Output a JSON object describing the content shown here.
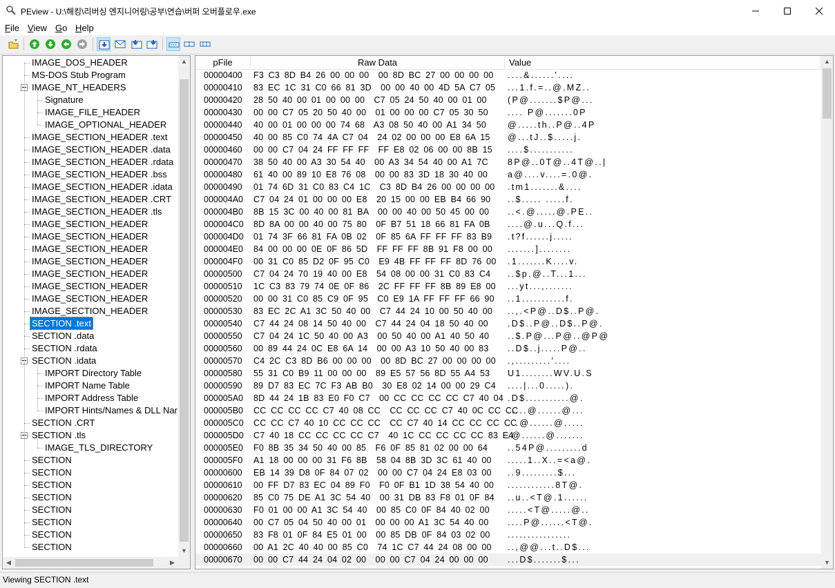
{
  "window": {
    "title": "PEview - U:\\해킹\\리버싱 엔지니어링\\공부\\연습\\버퍼 오버플로우.exe"
  },
  "menu": [
    {
      "label": "File",
      "u": "F",
      "rest": "ile"
    },
    {
      "label": "View",
      "u": "V",
      "rest": "iew"
    },
    {
      "label": "Go",
      "u": "G",
      "rest": "o"
    },
    {
      "label": "Help",
      "u": "H",
      "rest": "elp"
    }
  ],
  "toolbar": {
    "icons": [
      "open-icon",
      "back-icon",
      "forward-icon",
      "up-icon",
      "down-icon",
      "view-hex-icon",
      "view-mail-icon",
      "view-export-icon",
      "view-import-icon",
      "view-list-icon",
      "view-columns-icon",
      "view-details-icon"
    ]
  },
  "tree": [
    {
      "label": "IMAGE_DOS_HEADER",
      "level": 0
    },
    {
      "label": "MS-DOS Stub Program",
      "level": 0
    },
    {
      "label": "IMAGE_NT_HEADERS",
      "level": 0,
      "expander": true
    },
    {
      "label": "Signature",
      "level": 1
    },
    {
      "label": "IMAGE_FILE_HEADER",
      "level": 1
    },
    {
      "label": "IMAGE_OPTIONAL_HEADER",
      "level": 1
    },
    {
      "label": "IMAGE_SECTION_HEADER .text",
      "level": 0
    },
    {
      "label": "IMAGE_SECTION_HEADER .data",
      "level": 0
    },
    {
      "label": "IMAGE_SECTION_HEADER .rdata",
      "level": 0
    },
    {
      "label": "IMAGE_SECTION_HEADER .bss",
      "level": 0
    },
    {
      "label": "IMAGE_SECTION_HEADER .idata",
      "level": 0
    },
    {
      "label": "IMAGE_SECTION_HEADER .CRT",
      "level": 0
    },
    {
      "label": "IMAGE_SECTION_HEADER .tls",
      "level": 0
    },
    {
      "label": "IMAGE_SECTION_HEADER",
      "level": 0
    },
    {
      "label": "IMAGE_SECTION_HEADER",
      "level": 0
    },
    {
      "label": "IMAGE_SECTION_HEADER",
      "level": 0
    },
    {
      "label": "IMAGE_SECTION_HEADER",
      "level": 0
    },
    {
      "label": "IMAGE_SECTION_HEADER",
      "level": 0
    },
    {
      "label": "IMAGE_SECTION_HEADER",
      "level": 0
    },
    {
      "label": "IMAGE_SECTION_HEADER",
      "level": 0
    },
    {
      "label": "IMAGE_SECTION_HEADER",
      "level": 0
    },
    {
      "label": "SECTION .text",
      "level": 0,
      "selected": true
    },
    {
      "label": "SECTION .data",
      "level": 0
    },
    {
      "label": "SECTION .rdata",
      "level": 0
    },
    {
      "label": "SECTION .idata",
      "level": 0,
      "expander": true
    },
    {
      "label": "IMPORT Directory Table",
      "level": 1
    },
    {
      "label": "IMPORT Name Table",
      "level": 1
    },
    {
      "label": "IMPORT Address Table",
      "level": 1
    },
    {
      "label": "IMPORT Hints/Names & DLL Nar",
      "level": 1
    },
    {
      "label": "SECTION .CRT",
      "level": 0
    },
    {
      "label": "SECTION .tls",
      "level": 0,
      "expander": true
    },
    {
      "label": "IMAGE_TLS_DIRECTORY",
      "level": 1
    },
    {
      "label": "SECTION",
      "level": 0
    },
    {
      "label": "SECTION",
      "level": 0
    },
    {
      "label": "SECTION",
      "level": 0
    },
    {
      "label": "SECTION",
      "level": 0
    },
    {
      "label": "SECTION",
      "level": 0
    },
    {
      "label": "SECTION",
      "level": 0
    },
    {
      "label": "SECTION",
      "level": 0
    },
    {
      "label": "SECTION",
      "level": 0
    }
  ],
  "hex": {
    "columns": [
      "pFile",
      "Raw Data",
      "Value"
    ],
    "rows": [
      {
        "addr": "00000400",
        "raw": "F3 C3 8D B4 26 00 00 00  00 8D BC 27 00 00 00 00",
        "val": "....&......'...."
      },
      {
        "addr": "00000410",
        "raw": "83 EC 1C 31 C0 66 81 3D  00 00 40 00 4D 5A C7 05",
        "val": "...1.f.=..@.MZ.."
      },
      {
        "addr": "00000420",
        "raw": "28 50 40 00 01 00 00 00  C7 05 24 50 40 00 01 00",
        "val": "(P@.......$P@..."
      },
      {
        "addr": "00000430",
        "raw": "00 00 C7 05 20 50 40 00  01 00 00 00 C7 05 30 50",
        "val": ".... P@.......0P"
      },
      {
        "addr": "00000440",
        "raw": "40 00 01 00 00 00 74 68  A3 08 50 40 00 A1 34 50",
        "val": "@.....th..P@..4P"
      },
      {
        "addr": "00000450",
        "raw": "40 00 85 C0 74 4A C7 04  24 02 00 00 00 E8 6A 15",
        "val": "@...tJ..$.....j."
      },
      {
        "addr": "00000460",
        "raw": "00 00 C7 04 24 FF FF FF  FF E8 02 06 00 00 8B 15",
        "val": "....$..........."
      },
      {
        "addr": "00000470",
        "raw": "38 50 40 00 A3 30 54 40  00 A3 34 54 40 00 A1 7C",
        "val": "8P@..0T@..4T@..|"
      },
      {
        "addr": "00000480",
        "raw": "61 40 00 89 10 E8 76 08  00 00 83 3D 18 30 40 00",
        "val": "a@....v....=.0@."
      },
      {
        "addr": "00000490",
        "raw": "01 74 6D 31 C0 83 C4 1C  C3 8D B4 26 00 00 00 00",
        "val": ".tm1.......&...."
      },
      {
        "addr": "000004A0",
        "raw": "C7 04 24 01 00 00 00 E8  20 15 00 00 EB B4 66 90",
        "val": "..$..... .....f."
      },
      {
        "addr": "000004B0",
        "raw": "8B 15 3C 00 40 00 81 BA  00 00 40 00 50 45 00 00",
        "val": "..<.@.....@.PE.."
      },
      {
        "addr": "000004C0",
        "raw": "8D 8A 00 00 40 00 75 80  0F B7 51 18 66 81 FA 0B",
        "val": "....@.u...Q.f..."
      },
      {
        "addr": "000004D0",
        "raw": "01 74 3F 66 81 FA 0B 02  0F 85 6A FF FF FF 83 B9",
        "val": ".t?f......j....."
      },
      {
        "addr": "000004E0",
        "raw": "84 00 00 00 0E 0F 86 5D  FF FF FF 8B 91 F8 00 00",
        "val": ".......]........"
      },
      {
        "addr": "000004F0",
        "raw": "00 31 C0 85 D2 0F 95 C0  E9 4B FF FF FF 8D 76 00",
        "val": ".1.......K....v."
      },
      {
        "addr": "00000500",
        "raw": "C7 04 24 70 19 40 00 E8  54 08 00 00 31 C0 83 C4",
        "val": "..$p.@..T...1..."
      },
      {
        "addr": "00000510",
        "raw": "1C C3 83 79 74 0E 0F 86  2C FF FF FF 8B 89 E8 00",
        "val": "...yt...,......."
      },
      {
        "addr": "00000520",
        "raw": "00 00 31 C0 85 C9 0F 95  C0 E9 1A FF FF FF 66 90",
        "val": "..1...........f."
      },
      {
        "addr": "00000530",
        "raw": "83 EC 2C A1 3C 50 40 00  C7 44 24 10 00 50 40 00",
        "val": "..,.<P@..D$..P@."
      },
      {
        "addr": "00000540",
        "raw": "C7 44 24 08 14 50 40 00  C7 44 24 04 18 50 40 00",
        "val": ".D$..P@..D$..P@."
      },
      {
        "addr": "00000550",
        "raw": "C7 04 24 1C 50 40 00 A3  00 50 40 00 A1 40 50 40",
        "val": "..$.P@...P@..@P@"
      },
      {
        "addr": "00000560",
        "raw": "00 89 44 24 0C E8 6A 14  00 00 A3 10 50 40 00 83",
        "val": "..D$..j.....P@.."
      },
      {
        "addr": "00000570",
        "raw": "C4 2C C3 8D B6 00 00 00  00 8D BC 27 00 00 00 00",
        "val": ".,.........'...."
      },
      {
        "addr": "00000580",
        "raw": "55 31 C0 B9 11 00 00 00  89 E5 57 56 8D 55 A4 53",
        "val": "U1........WV.U.S"
      },
      {
        "addr": "00000590",
        "raw": "89 D7 83 EC 7C F3 AB B0  30 E8 02 14 00 00 29 C4",
        "val": "....|...0.....)."
      },
      {
        "addr": "000005A0",
        "raw": "8D 44 24 1B 83 E0 F0 C7  00 CC CC CC CC C7 40 04",
        "val": ".D$...........@."
      },
      {
        "addr": "000005B0",
        "raw": "CC CC CC CC C7 40 08 CC  CC CC CC C7 40 0C CC CC",
        "val": ".....@......@..."
      },
      {
        "addr": "000005C0",
        "raw": "CC CC C7 40 10 CC CC CC  CC C7 40 14 CC CC CC CC",
        "val": "...@......@....."
      },
      {
        "addr": "000005D0",
        "raw": "C7 40 18 CC CC CC CC C7  40 1C CC CC CC CC 83 E4",
        "val": ".@......@......."
      },
      {
        "addr": "000005E0",
        "raw": "F0 8B 35 34 50 40 00 85  F6 0F 85 81 02 00 00 64",
        "val": "..54P@.........d"
      },
      {
        "addr": "000005F0",
        "raw": "A1 18 00 00 00 31 F6 8B  58 04 8B 3D 3C 61 40 00",
        "val": ".....1..X..=<a@."
      },
      {
        "addr": "00000600",
        "raw": "EB 14 39 D8 0F 84 07 02  00 00 C7 04 24 E8 03 00",
        "val": "..9.........$..."
      },
      {
        "addr": "00000610",
        "raw": "00 FF D7 83 EC 04 89 F0  F0 0F B1 1D 38 54 40 00",
        "val": "............8T@."
      },
      {
        "addr": "00000620",
        "raw": "85 C0 75 DE A1 3C 54 40  00 31 DB 83 F8 01 0F 84",
        "val": "..u..<T@.1......"
      },
      {
        "addr": "00000630",
        "raw": "F0 01 00 00 A1 3C 54 40  00 85 C0 0F 84 40 02 00",
        "val": ".....<T@.....@.."
      },
      {
        "addr": "00000640",
        "raw": "00 C7 05 04 50 40 00 01  00 00 00 A1 3C 54 40 00",
        "val": "....P@......<T@."
      },
      {
        "addr": "00000650",
        "raw": "83 F8 01 0F 84 E5 01 00  00 85 DB 0F 84 03 02 00",
        "val": "................"
      },
      {
        "addr": "00000660",
        "raw": "00 A1 2C 40 40 00 85 C0  74 1C C7 44 24 08 00 00",
        "val": "..,@@...t..D$..."
      },
      {
        "addr": "00000670",
        "raw": "00 00 C7 44 24 04 02 00  00 00 C7 04 24 00 00 00",
        "val": "...D$.......$...",
        "hl": true
      }
    ]
  },
  "status": {
    "text": "Viewing SECTION .text"
  }
}
